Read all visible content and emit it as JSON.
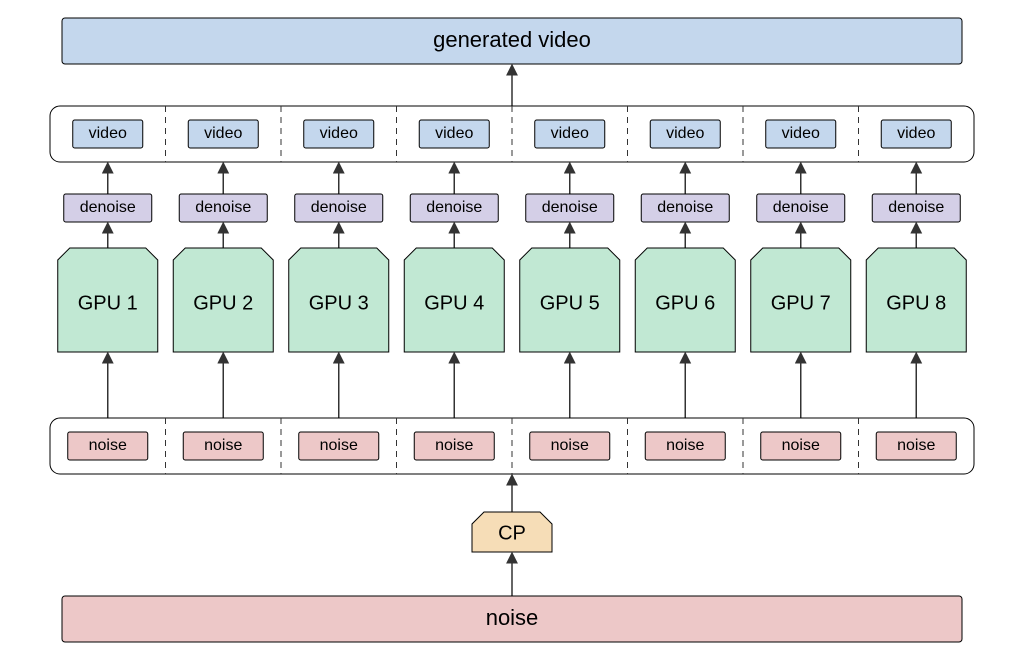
{
  "colors": {
    "blue": "#c4d7ed",
    "purple": "#d4cfe7",
    "green": "#c1e8d3",
    "pink": "#edc8c8",
    "peach": "#f6ddb7",
    "border": "#000000"
  },
  "top": {
    "generated_video": "generated video"
  },
  "tags": {
    "video": "video",
    "denoise": "denoise",
    "gpu": [
      "GPU 1",
      "GPU 2",
      "GPU 3",
      "GPU 4",
      "GPU 5",
      "GPU 6",
      "GPU 7",
      "GPU 8"
    ],
    "noise": "noise"
  },
  "cp": "CP",
  "bottom_noise": "noise",
  "count": 8
}
